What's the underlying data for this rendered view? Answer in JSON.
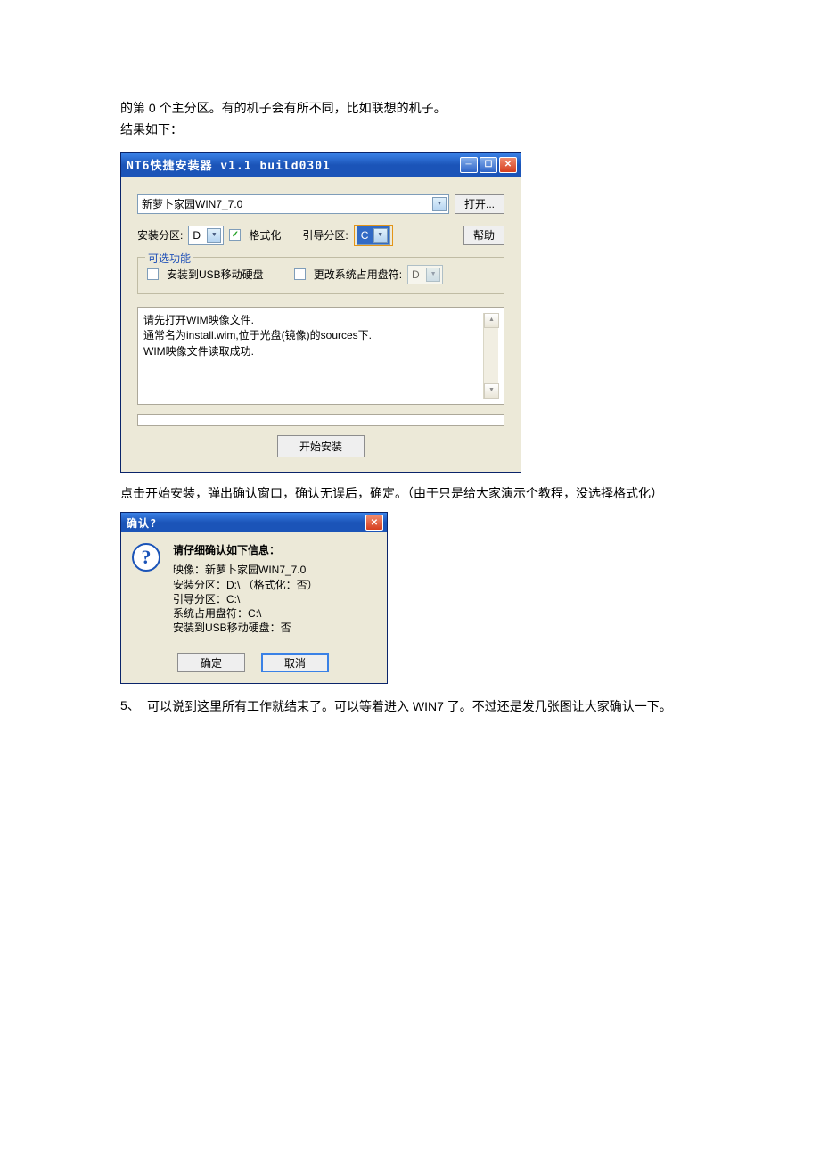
{
  "doc": {
    "line1": "的第 0 个主分区。有的机子会有所不同，比如联想的机子。",
    "line2": "结果如下：",
    "after_install": "点击开始安装，弹出确认窗口，确认无误后，确定。（由于只是给大家演示个教程，没选择格式化）",
    "step5_num": "5、",
    "step5_txt": "可以说到这里所有工作就结束了。可以等着进入 WIN7 了。不过还是发几张图让大家确认一下。"
  },
  "installer": {
    "title": "NT6快捷安装器 v1.1 build0301",
    "image_name": "新萝卜家园WIN7_7.0",
    "open_btn": "打开...",
    "install_part_label": "安装分区:",
    "install_part": "D",
    "format_label": "格式化",
    "boot_part_label": "引导分区:",
    "boot_part": "C",
    "help_btn": "帮助",
    "optional_legend": "可选功能",
    "usb_label": "安装到USB移动硬盘",
    "change_drive_label": "更改系统占用盘符:",
    "change_drive_val": "D",
    "log_line1": "请先打开WIM映像文件.",
    "log_line2": "通常名为install.wim,位于光盘(镜像)的sources下.",
    "log_line3": "WIM映像文件读取成功.",
    "start_btn": "开始安装"
  },
  "confirm": {
    "title": "确认?",
    "header": "请仔细确认如下信息：",
    "l1": "映像：新萝卜家园WIN7_7.0",
    "l2": "安装分区：D:\\ （格式化：否）",
    "l3": "引导分区：C:\\",
    "l4": "系统占用盘符：C:\\",
    "l5": "安装到USB移动硬盘：否",
    "ok": "确定",
    "cancel": "取消"
  }
}
